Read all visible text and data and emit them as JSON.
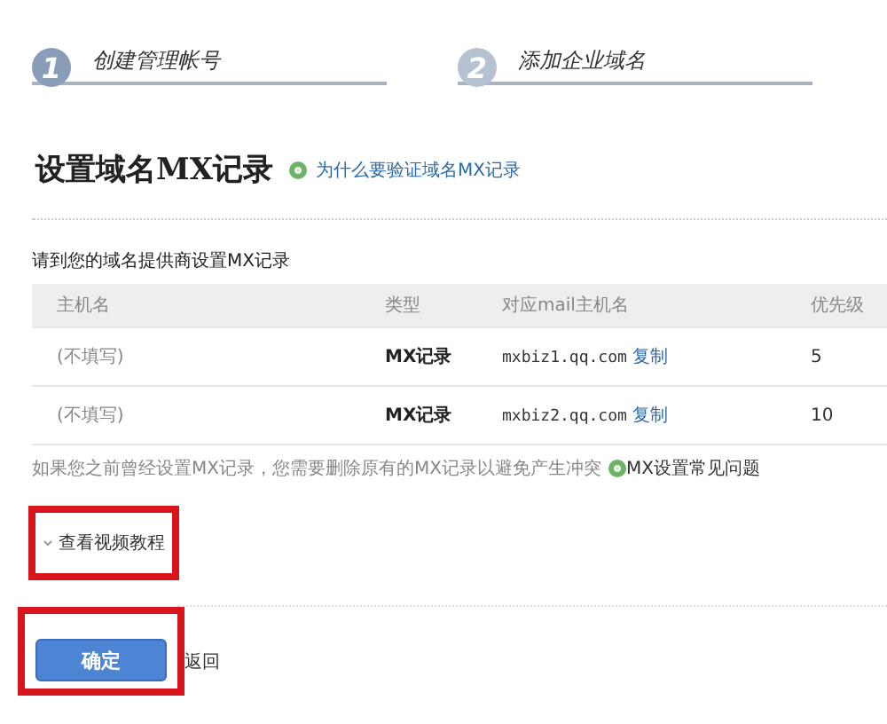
{
  "steps": [
    {
      "number": "1",
      "label": "创建管理帐号",
      "selected": true
    },
    {
      "number": "2",
      "label": "添加企业域名",
      "selected": false
    }
  ],
  "heading": {
    "title": "设置域名MX记录",
    "help_link": "为什么要验证域名MX记录"
  },
  "instruction": "请到您的域名提供商设置MX记录",
  "table": {
    "columns": [
      "主机名",
      "类型",
      "对应mail主机名",
      "优先级"
    ],
    "rows": [
      {
        "host": "(不填写)",
        "type": "MX记录",
        "mail_host": "mxbiz1.qq.com",
        "copy": "复制",
        "priority": "5"
      },
      {
        "host": "(不填写)",
        "type": "MX记录",
        "mail_host": "mxbiz2.qq.com",
        "copy": "复制",
        "priority": "10"
      }
    ]
  },
  "note": {
    "text": "如果您之前曾经设置MX记录，您需要删除原有的MX记录以避免产生冲突",
    "faq_link": "MX设置常见问题"
  },
  "video_link": {
    "label": "查看视频教程",
    "highlighted": true
  },
  "buttons": {
    "confirm": {
      "label": "确定",
      "highlighted": true
    },
    "back": "返回"
  }
}
